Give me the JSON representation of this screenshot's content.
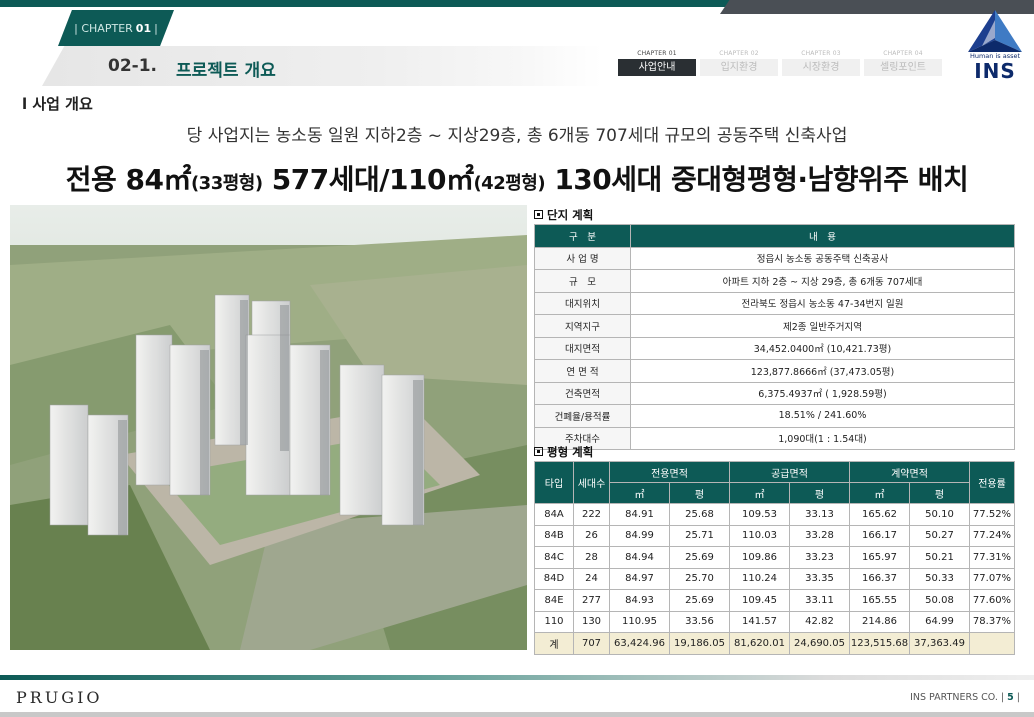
{
  "header": {
    "chapter_prefix": "| CHAPTER",
    "chapter_num": "01",
    "chapter_suffix": "|",
    "section_num": "02-1.",
    "section_title": "프로젝트 개요"
  },
  "nav": [
    {
      "chapter": "CHAPTER 01",
      "label": "사업안내",
      "active": true
    },
    {
      "chapter": "CHAPTER 02",
      "label": "입지환경",
      "active": false
    },
    {
      "chapter": "CHAPTER 03",
      "label": "시장환경",
      "active": false
    },
    {
      "chapter": "CHAPTER 04",
      "label": "셀링포인트",
      "active": false
    }
  ],
  "logo": {
    "tagline": "Human is asset",
    "name": "INS"
  },
  "sub_heading": "l 사업 개요",
  "intro": "당 사업지는 농소동 일원 지하2층 ~ 지상29층, 총 6개동 707세대 규모의 공동주택 신축사업",
  "headline": {
    "p1": "전용 84㎡",
    "p2": "(33평형)",
    "p3": " 577세대/110㎡",
    "p4": "(42평형)",
    "p5": " 130세대 중대형평형·남향위주 배치"
  },
  "complex_plan": {
    "title": "단지 계획",
    "header": [
      "구　분",
      "내　용"
    ],
    "rows": [
      [
        "사 업 명",
        "정읍시 농소동 공동주택 신축공사"
      ],
      [
        "규　모",
        "아파트 지하 2층 ~ 지상 29층, 총 6개동 707세대"
      ],
      [
        "대지위치",
        "전라북도 정읍시 농소동 47-34번지 일원"
      ],
      [
        "지역지구",
        "제2종 일반주거지역"
      ],
      [
        "대지면적",
        "34,452.0400㎡ (10,421.73평)"
      ],
      [
        "연 면 적",
        "123,877.8666㎡ (37,473.05평)"
      ],
      [
        "건축면적",
        "6,375.4937㎡ (  1,928.59평)"
      ],
      [
        "건폐율/용적률",
        "18.51% / 241.60%"
      ],
      [
        "주차대수",
        "1,090대(1 : 1.54대)"
      ]
    ]
  },
  "unit_plan": {
    "title": "평형 계획",
    "h_type": "타입",
    "h_units": "세대수",
    "h_exclusive": "전용면적",
    "h_supply": "공급면적",
    "h_contract": "계약면적",
    "h_ratio": "전용률",
    "h_m2": "㎡",
    "h_py": "평",
    "rows": [
      [
        "84A",
        "222",
        "84.91",
        "25.68",
        "109.53",
        "33.13",
        "165.62",
        "50.10",
        "77.52%"
      ],
      [
        "84B",
        "26",
        "84.99",
        "25.71",
        "110.03",
        "33.28",
        "166.17",
        "50.27",
        "77.24%"
      ],
      [
        "84C",
        "28",
        "84.94",
        "25.69",
        "109.86",
        "33.23",
        "165.97",
        "50.21",
        "77.31%"
      ],
      [
        "84D",
        "24",
        "84.97",
        "25.70",
        "110.24",
        "33.35",
        "166.37",
        "50.33",
        "77.07%"
      ],
      [
        "84E",
        "277",
        "84.93",
        "25.69",
        "109.45",
        "33.11",
        "165.55",
        "50.08",
        "77.60%"
      ],
      [
        "110",
        "130",
        "110.95",
        "33.56",
        "141.57",
        "42.82",
        "214.86",
        "64.99",
        "78.37%"
      ]
    ],
    "total": [
      "계",
      "707",
      "63,424.96",
      "19,186.05",
      "81,620.01",
      "24,690.05",
      "123,515.68",
      "37,363.49",
      ""
    ]
  },
  "footer": {
    "brand": "PRUGIO",
    "company": "INS PARTNERS CO.",
    "page": "5"
  },
  "colors": {
    "accent": "#0d5a56",
    "nav_active": "#2a2f33",
    "total_row": "#f3edd4"
  }
}
